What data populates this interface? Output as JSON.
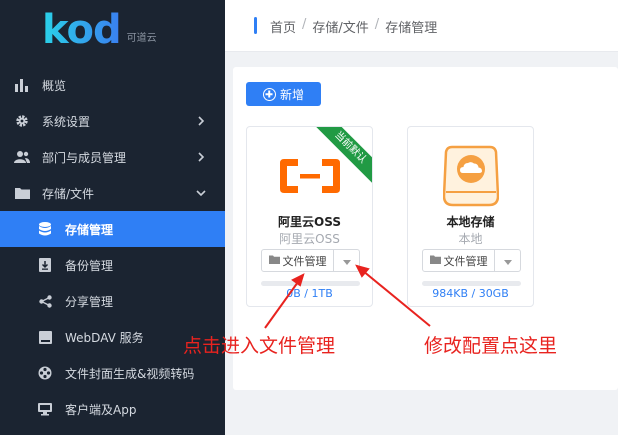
{
  "logo": {
    "text": "kod",
    "sub": "可道云"
  },
  "menu": [
    {
      "label": "概览",
      "icon": "bar-chart-icon",
      "name": "menu-item-overview"
    },
    {
      "label": "系统设置",
      "icon": "gear-icon",
      "name": "menu-item-system-settings",
      "chevron": "right"
    },
    {
      "label": "部门与成员管理",
      "icon": "users-icon",
      "name": "menu-item-departments",
      "chevron": "right"
    },
    {
      "label": "存储/文件",
      "icon": "folder-icon",
      "name": "menu-item-storage",
      "chevron": "down"
    },
    {
      "label": "存储管理",
      "icon": "database-icon",
      "name": "menu-item-storage-management",
      "sub": true,
      "active": true
    },
    {
      "label": "备份管理",
      "icon": "backup-icon",
      "name": "menu-item-backup",
      "sub": true
    },
    {
      "label": "分享管理",
      "icon": "share-icon",
      "name": "menu-item-share",
      "sub": true
    },
    {
      "label": "WebDAV 服务",
      "icon": "drive-icon",
      "name": "menu-item-webdav",
      "sub": true
    },
    {
      "label": "文件封面生成&视频转码",
      "icon": "film-reel-icon",
      "name": "menu-item-transcode",
      "sub": true
    },
    {
      "label": "客户端及App",
      "icon": "monitor-icon",
      "name": "menu-item-client",
      "sub": true
    }
  ],
  "breadcrumb": {
    "items": [
      "首页",
      "存储/文件",
      "存储管理"
    ],
    "separator": "/"
  },
  "toolbar": {
    "add_label": "新增"
  },
  "cards": [
    {
      "name": "阿里云OSS",
      "sub": "阿里云OSS",
      "ribbon": "当前默认",
      "button": "文件管理",
      "usage": "0B / 1TB",
      "progress": 0.0,
      "icon": "aliyun-logo-icon"
    },
    {
      "name": "本地存储",
      "sub": "本地",
      "button": "文件管理",
      "usage": "984KB / 30GB",
      "progress": 0.0,
      "icon": "local-disk-icon"
    }
  ],
  "annotations": {
    "left": "点击进入文件管理",
    "right": "修改配置点这里"
  },
  "colors": {
    "sidebar_bg": "#1b2431",
    "accent": "#2f7ff5",
    "aliyun_orange": "#ff6a00",
    "disk_orange": "#f5a042",
    "ribbon_green": "#219a44",
    "annotation_red": "#e8231f"
  }
}
